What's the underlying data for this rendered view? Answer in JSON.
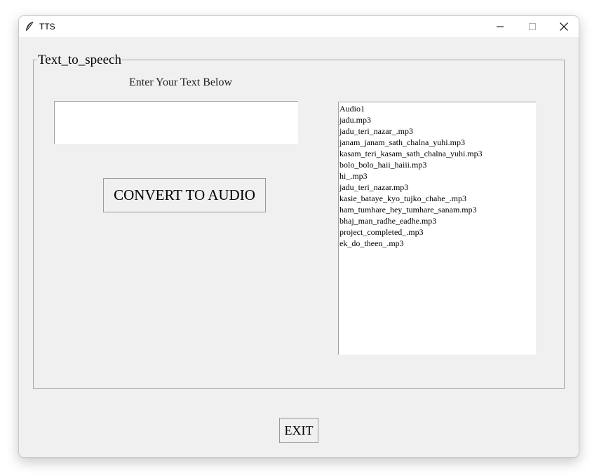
{
  "window": {
    "title": "TTS",
    "icon": "feather-icon",
    "controls": {
      "minimize_icon": "minimize-icon",
      "maximize_icon": "maximize-icon",
      "close_icon": "close-icon"
    }
  },
  "frame": {
    "legend": "Text_to_speech"
  },
  "input_section": {
    "prompt": "Enter Your Text Below",
    "text_value": ""
  },
  "convert_button": {
    "label": "CONVERT TO AUDIO"
  },
  "audio_list": {
    "items": [
      "Audio1",
      "jadu.mp3",
      "jadu_teri_nazar_.mp3",
      "janam_janam_sath_chalna_yuhi.mp3",
      "kasam_teri_kasam_sath_chalna_yuhi.mp3",
      "bolo_bolo_haii_haiii.mp3",
      "hi_.mp3",
      "jadu_teri_nazar.mp3",
      "kasie_bataye_kyo_tujko_chahe_.mp3",
      "ham_tumhare_hey_tumhare_sanam.mp3",
      "bhaj_man_radhe_eadhe.mp3",
      "project_completed_.mp3",
      "ek_do_theen_.mp3"
    ]
  },
  "exit_button": {
    "label": "EXIT"
  }
}
